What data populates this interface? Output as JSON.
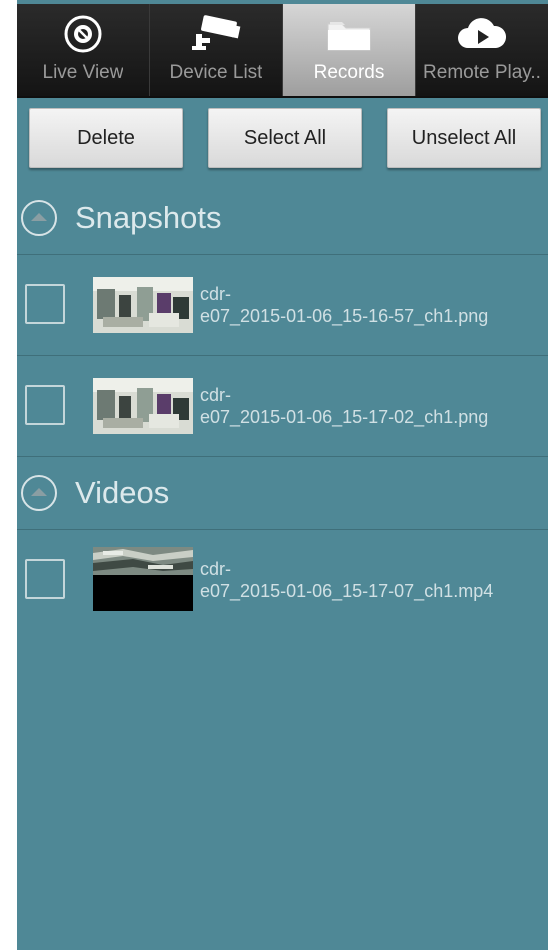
{
  "tabs": [
    {
      "label": "Live View",
      "icon": "live-view-icon",
      "active": false
    },
    {
      "label": "Device List",
      "icon": "camera-icon",
      "active": false
    },
    {
      "label": "Records",
      "icon": "folder-icon",
      "active": true
    },
    {
      "label": "Remote Play..",
      "icon": "cloud-play-icon",
      "active": false
    }
  ],
  "toolbar": {
    "delete_label": "Delete",
    "select_all_label": "Select All",
    "unselect_all_label": "Unselect All"
  },
  "sections": {
    "snapshots": {
      "title": "Snapshots",
      "items": [
        {
          "name_line1": "cdr-",
          "name_line2": "e07_2015-01-06_15-16-57_ch1.png"
        },
        {
          "name_line1": "cdr-",
          "name_line2": "e07_2015-01-06_15-17-02_ch1.png"
        }
      ]
    },
    "videos": {
      "title": "Videos",
      "items": [
        {
          "name_line1": "cdr-",
          "name_line2": "e07_2015-01-06_15-17-07_ch1.mp4"
        }
      ]
    }
  },
  "colors": {
    "background": "#4f8896",
    "tabbar": "#1c1c1c",
    "active_tab": "#bdbdbd"
  }
}
